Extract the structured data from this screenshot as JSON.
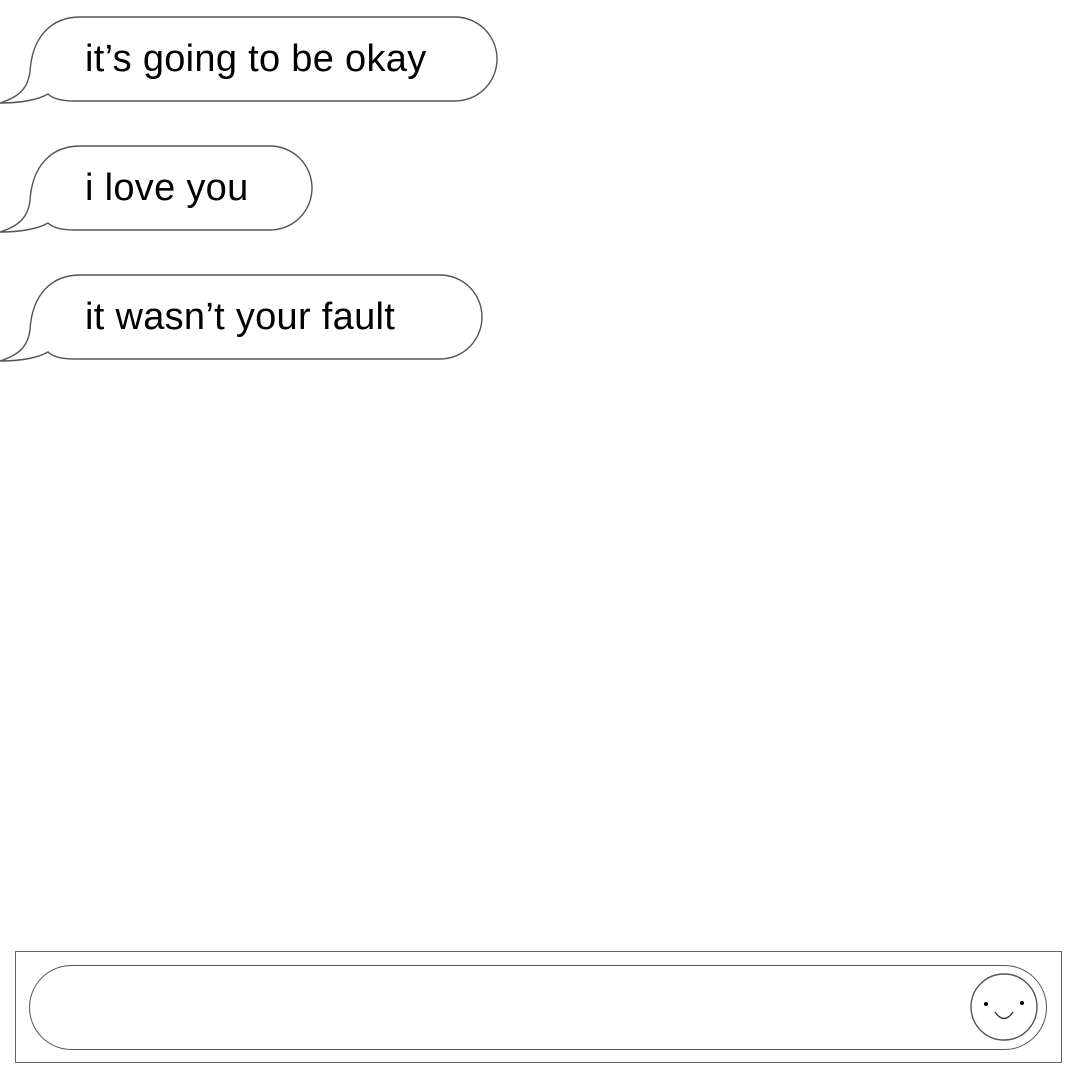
{
  "messages": [
    {
      "text": "it’s going to be okay"
    },
    {
      "text": "i love you"
    },
    {
      "text": "it wasn’t your fault"
    }
  ],
  "composer": {
    "value": "",
    "emoji_button_icon": "smiley-face-icon"
  },
  "colors": {
    "background": "#ffffff",
    "outline": "#555555",
    "text": "#000000"
  }
}
